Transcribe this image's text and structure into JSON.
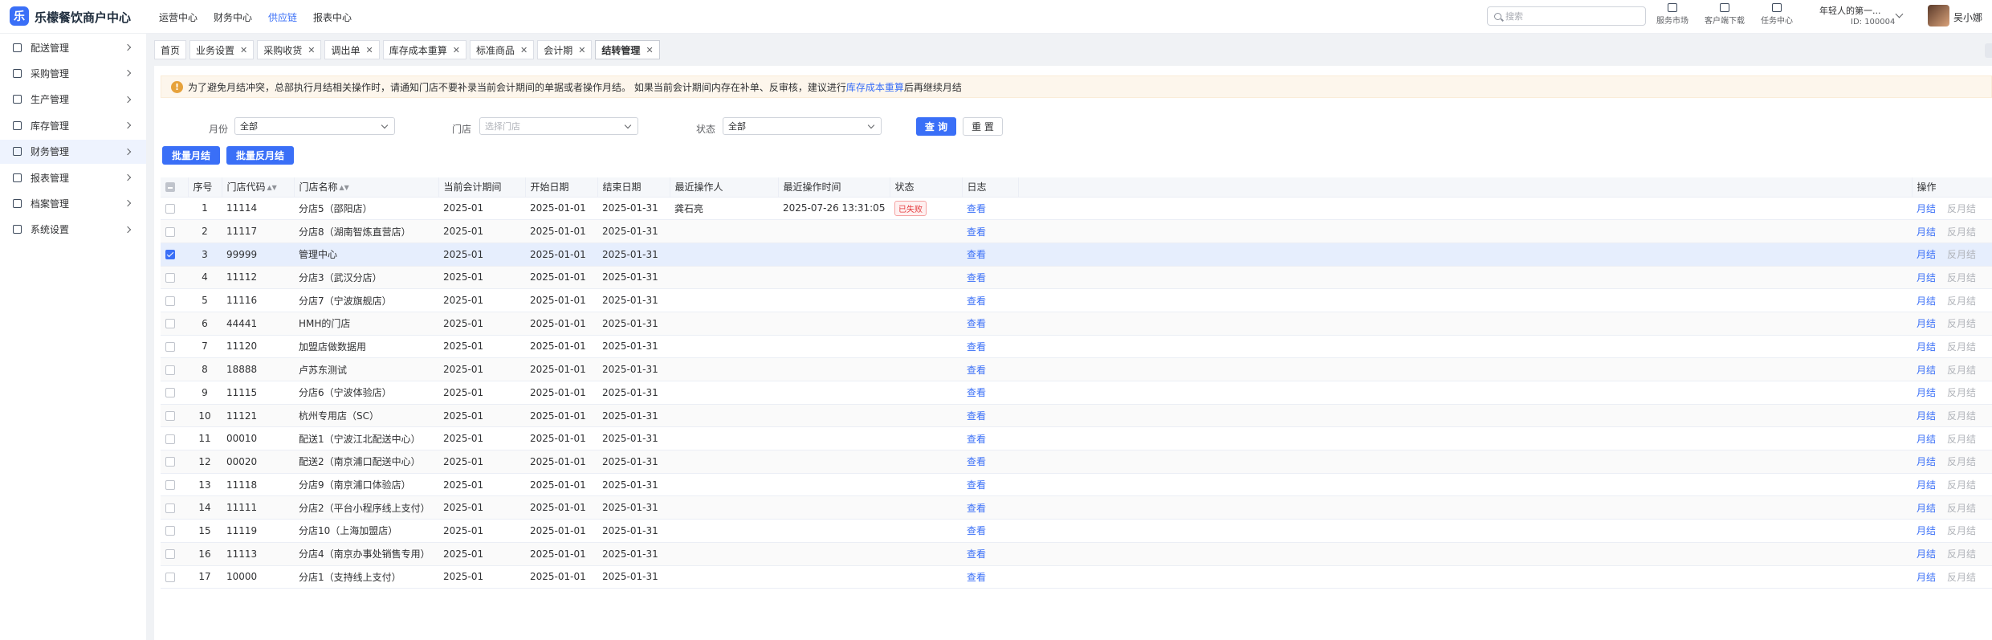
{
  "app": {
    "logo_glyph": "乐",
    "title": "乐檬餐饮商户中心"
  },
  "topnav": [
    "运营中心",
    "财务中心",
    "供应链",
    "报表中心"
  ],
  "topnav_active": 2,
  "search": {
    "placeholder": "搜索"
  },
  "tools": [
    {
      "label": "服务市场",
      "icon": "shop-icon"
    },
    {
      "label": "客户端下载",
      "icon": "download-folder-icon"
    },
    {
      "label": "任务中心",
      "icon": "task-icon"
    }
  ],
  "user": {
    "org": "年轻人的第一...",
    "id": "ID: 100004",
    "name": "吴小娜"
  },
  "sidebar": [
    {
      "label": "配送管理",
      "icon": "delivery-icon"
    },
    {
      "label": "采购管理",
      "icon": "cart-icon"
    },
    {
      "label": "生产管理",
      "icon": "production-icon"
    },
    {
      "label": "库存管理",
      "icon": "warehouse-icon"
    },
    {
      "label": "财务管理",
      "icon": "finance-icon",
      "active": true
    },
    {
      "label": "报表管理",
      "icon": "report-icon"
    },
    {
      "label": "档案管理",
      "icon": "archive-icon"
    },
    {
      "label": "系统设置",
      "icon": "settings-icon"
    }
  ],
  "tabs": [
    {
      "label": "首页",
      "closable": false
    },
    {
      "label": "业务设置",
      "closable": true
    },
    {
      "label": "采购收货",
      "closable": true
    },
    {
      "label": "调出单",
      "closable": true
    },
    {
      "label": "库存成本重算",
      "closable": true
    },
    {
      "label": "标准商品",
      "closable": true
    },
    {
      "label": "会计期",
      "closable": true
    },
    {
      "label": "结转管理",
      "closable": true,
      "active": true
    }
  ],
  "alert": {
    "icon": "!",
    "text_before": "为了避免月结冲突，总部执行月结相关操作时，请通知门店不要补录当前会计期间的单据或者操作月结。 如果当前会计期间内存在补单、反审核，建议进行",
    "link": "库存成本重算",
    "text_after": "后再继续月结"
  },
  "filters": {
    "month": {
      "label": "月份",
      "value": "全部"
    },
    "store": {
      "label": "门店",
      "placeholder": "选择门店"
    },
    "status": {
      "label": "状态",
      "value": "全部"
    },
    "query_label": "查 询",
    "reset_label": "重 置"
  },
  "batch": {
    "month_end": "批量月结",
    "reverse": "批量反月结"
  },
  "table": {
    "headers": {
      "seq": "序号",
      "code": "门店代码",
      "name": "门店名称",
      "period": "当前会计期间",
      "start": "开始日期",
      "end": "结束日期",
      "operator": "最近操作人",
      "op_time": "最近操作时间",
      "status": "状态",
      "log": "日志",
      "actions": "操作"
    },
    "log_label": "查看",
    "action_month_end": "月结",
    "action_reverse": "反月结",
    "rows": [
      {
        "seq": "1",
        "code": "11114",
        "name": "分店5（邵阳店）",
        "period": "2025-01",
        "start": "2025-01-01",
        "end": "2025-01-31",
        "operator": "龚石亮",
        "op_time": "2025-07-26 13:31:05",
        "status": "已失败",
        "checked": false
      },
      {
        "seq": "2",
        "code": "11117",
        "name": "分店8（湖南智炼直营店）",
        "period": "2025-01",
        "start": "2025-01-01",
        "end": "2025-01-31",
        "operator": "",
        "op_time": "",
        "status": "",
        "checked": false
      },
      {
        "seq": "3",
        "code": "99999",
        "name": "管理中心",
        "period": "2025-01",
        "start": "2025-01-01",
        "end": "2025-01-31",
        "operator": "",
        "op_time": "",
        "status": "",
        "checked": true
      },
      {
        "seq": "4",
        "code": "11112",
        "name": "分店3（武汉分店）",
        "period": "2025-01",
        "start": "2025-01-01",
        "end": "2025-01-31",
        "operator": "",
        "op_time": "",
        "status": "",
        "checked": false
      },
      {
        "seq": "5",
        "code": "11116",
        "name": "分店7（宁波旗舰店）",
        "period": "2025-01",
        "start": "2025-01-01",
        "end": "2025-01-31",
        "operator": "",
        "op_time": "",
        "status": "",
        "checked": false
      },
      {
        "seq": "6",
        "code": "44441",
        "name": "HMH的门店",
        "period": "2025-01",
        "start": "2025-01-01",
        "end": "2025-01-31",
        "operator": "",
        "op_time": "",
        "status": "",
        "checked": false
      },
      {
        "seq": "7",
        "code": "11120",
        "name": "加盟店做数据用",
        "period": "2025-01",
        "start": "2025-01-01",
        "end": "2025-01-31",
        "operator": "",
        "op_time": "",
        "status": "",
        "checked": false
      },
      {
        "seq": "8",
        "code": "18888",
        "name": "卢苏东测试",
        "period": "2025-01",
        "start": "2025-01-01",
        "end": "2025-01-31",
        "operator": "",
        "op_time": "",
        "status": "",
        "checked": false
      },
      {
        "seq": "9",
        "code": "11115",
        "name": "分店6（宁波体验店）",
        "period": "2025-01",
        "start": "2025-01-01",
        "end": "2025-01-31",
        "operator": "",
        "op_time": "",
        "status": "",
        "checked": false
      },
      {
        "seq": "10",
        "code": "11121",
        "name": "杭州专用店（SC）",
        "period": "2025-01",
        "start": "2025-01-01",
        "end": "2025-01-31",
        "operator": "",
        "op_time": "",
        "status": "",
        "checked": false
      },
      {
        "seq": "11",
        "code": "00010",
        "name": "配送1（宁波江北配送中心）",
        "period": "2025-01",
        "start": "2025-01-01",
        "end": "2025-01-31",
        "operator": "",
        "op_time": "",
        "status": "",
        "checked": false
      },
      {
        "seq": "12",
        "code": "00020",
        "name": "配送2（南京浦口配送中心）",
        "period": "2025-01",
        "start": "2025-01-01",
        "end": "2025-01-31",
        "operator": "",
        "op_time": "",
        "status": "",
        "checked": false
      },
      {
        "seq": "13",
        "code": "11118",
        "name": "分店9（南京浦口体验店）",
        "period": "2025-01",
        "start": "2025-01-01",
        "end": "2025-01-31",
        "operator": "",
        "op_time": "",
        "status": "",
        "checked": false
      },
      {
        "seq": "14",
        "code": "11111",
        "name": "分店2（平台小程序线上支付）",
        "period": "2025-01",
        "start": "2025-01-01",
        "end": "2025-01-31",
        "operator": "",
        "op_time": "",
        "status": "",
        "checked": false
      },
      {
        "seq": "15",
        "code": "11119",
        "name": "分店10（上海加盟店）",
        "period": "2025-01",
        "start": "2025-01-01",
        "end": "2025-01-31",
        "operator": "",
        "op_time": "",
        "status": "",
        "checked": false
      },
      {
        "seq": "16",
        "code": "11113",
        "name": "分店4（南京办事处销售专用）",
        "period": "2025-01",
        "start": "2025-01-01",
        "end": "2025-01-31",
        "operator": "",
        "op_time": "",
        "status": "",
        "checked": false
      },
      {
        "seq": "17",
        "code": "10000",
        "name": "分店1（支持线上支付）",
        "period": "2025-01",
        "start": "2025-01-01",
        "end": "2025-01-31",
        "operator": "",
        "op_time": "",
        "status": "",
        "checked": false
      }
    ]
  },
  "colors": {
    "primary": "#3a6ff7",
    "warning": "#e6a23c",
    "danger": "#e4393c"
  }
}
